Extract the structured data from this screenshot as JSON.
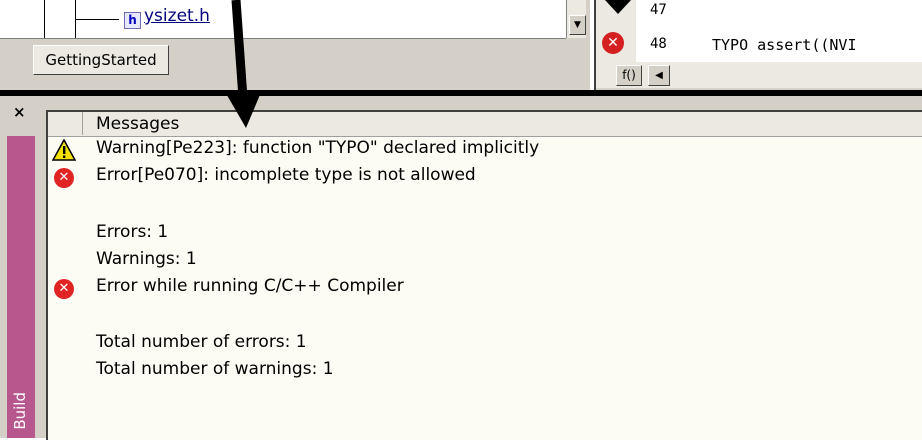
{
  "workspace": {
    "tree_file_name": "ysizet.h",
    "file_icon_letter": "h",
    "tab_label": "GettingStarted"
  },
  "editor": {
    "line_numbers": [
      "47",
      "48"
    ],
    "code_line_48": "TYPO assert((NVI",
    "func_button_label": "f()",
    "error_marker_icon": "error-icon"
  },
  "build_window": {
    "tab_label": "Build",
    "close_label": "×",
    "column_header": "Messages",
    "messages": [
      {
        "icon": "warning-icon",
        "text": "Warning[Pe223]: function \"TYPO\" declared implicitly"
      },
      {
        "icon": "error-icon",
        "text": "Error[Pe070]: incomplete type is not allowed"
      },
      {
        "icon": "",
        "text": ""
      },
      {
        "icon": "",
        "text": "Errors: 1"
      },
      {
        "icon": "",
        "text": "Warnings: 1"
      },
      {
        "icon": "error-icon",
        "text": "Error while running C/C++ Compiler"
      },
      {
        "icon": "",
        "text": ""
      },
      {
        "icon": "",
        "text": "Total number of errors: 1"
      },
      {
        "icon": "",
        "text": "Total number of warnings: 1"
      }
    ]
  },
  "colors": {
    "build_tab": "#b8578e",
    "error": "#e02424",
    "warning": "#f5e000",
    "panel_bg": "#fcfbf4"
  }
}
